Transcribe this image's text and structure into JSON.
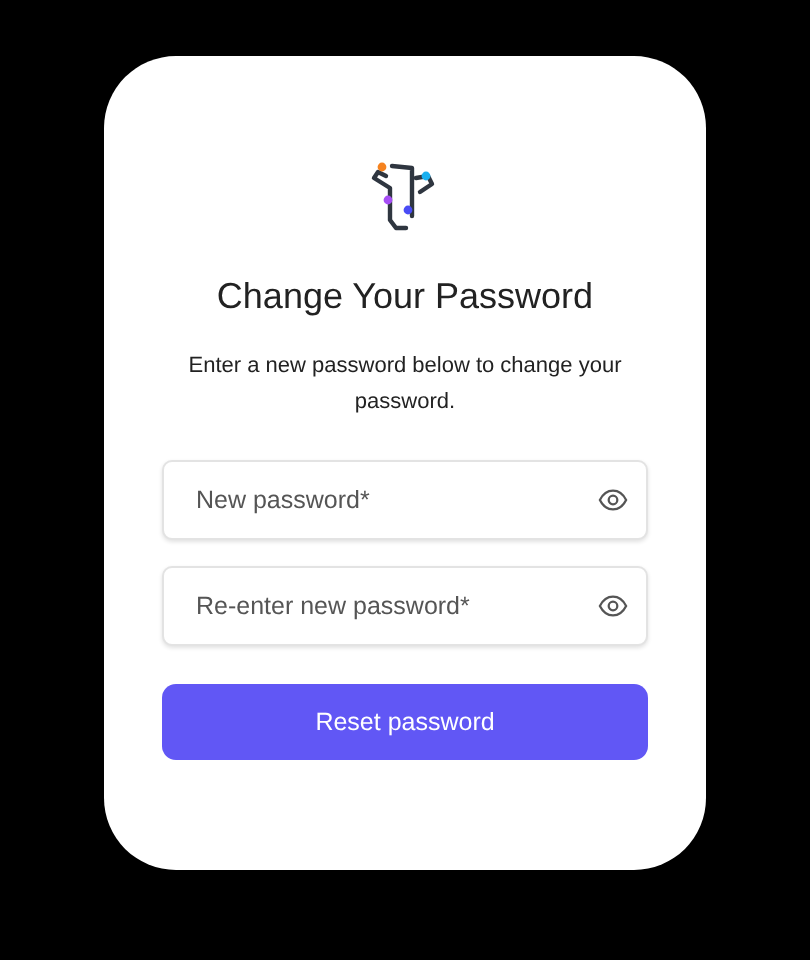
{
  "title": "Change Your Password",
  "description": "Enter a new password below to change your password.",
  "fields": [
    {
      "placeholder": "New password*"
    },
    {
      "placeholder": "Re-enter new password*"
    }
  ],
  "button": "Reset password"
}
